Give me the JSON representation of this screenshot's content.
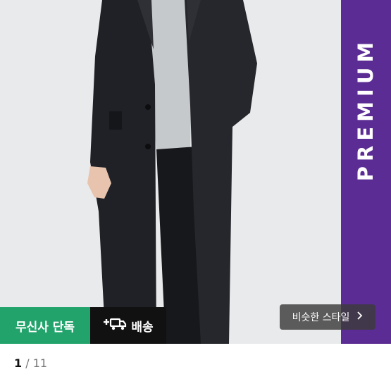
{
  "premium": {
    "label": "PREMIUM",
    "color": "#5b2c93"
  },
  "badges": {
    "exclusive": "무신사 단독",
    "delivery": "배송",
    "delivery_icon": "plus-truck-icon"
  },
  "similar_style": {
    "label": "비슷한 스타일",
    "icon": "chevron-right-icon"
  },
  "pager": {
    "current": "1",
    "separator": " / ",
    "total": "11"
  }
}
